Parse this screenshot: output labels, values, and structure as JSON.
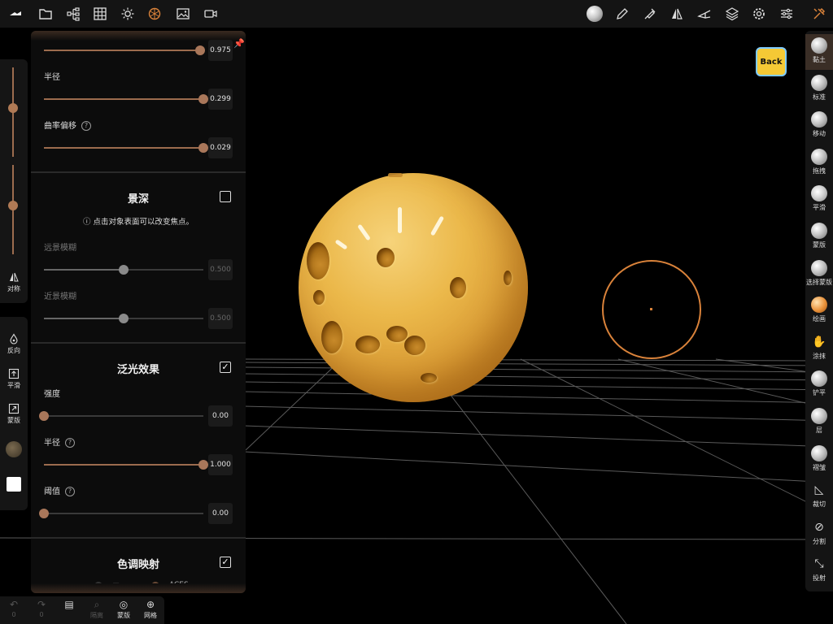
{
  "toolbar": {
    "left_icons": [
      "scene-logo-icon",
      "folder-icon",
      "scene-tree-icon",
      "grid-icon",
      "light-icon",
      "material-icon",
      "image-icon",
      "video-icon"
    ],
    "right_icons": [
      "matcap-icon",
      "pen-icon",
      "stroke-icon",
      "symmetry-icon",
      "camera-icon",
      "layers-icon",
      "settings-icon",
      "sliders-icon",
      "tools-icon"
    ]
  },
  "panel": {
    "top_value": "0.975",
    "radius_label": "半径",
    "radius_value": "0.299",
    "curvature_label": "曲率偏移",
    "curvature_value": "0.029",
    "dof": {
      "title": "景深",
      "info": "点击对象表面可以改变焦点。",
      "far_label": "远景模糊",
      "far_value": "0.500",
      "near_label": "近景模糊",
      "near_value": "0.500",
      "enabled": false
    },
    "bloom": {
      "title": "泛光效果",
      "enabled": true,
      "intensity_label": "强度",
      "intensity_value": "0.00",
      "radius_label": "半径",
      "radius_value": "1.000",
      "threshold_label": "阈值",
      "threshold_value": "0.00"
    },
    "tonemap": {
      "title": "色调映射",
      "enabled": true,
      "option_none": "无",
      "option_aces": "ACES"
    },
    "slider_levels": {
      "top": 0.98,
      "radius": 1.0,
      "curvature": 1.0,
      "far": 0.5,
      "near": 0.5,
      "intensity": 0.0,
      "bloom_radius": 1.0,
      "threshold": 0.0
    }
  },
  "left_strip": {
    "symmetry_label": "对称",
    "invert_label": "反向",
    "smooth_label": "平滑",
    "mask_label": "蒙版",
    "slider_levels": {
      "top": 0.55,
      "bottom": 0.55
    }
  },
  "right_tools": [
    {
      "label": "黏土",
      "icon": "clay-brush-icon",
      "active": true
    },
    {
      "label": "标准",
      "icon": "standard-brush-icon"
    },
    {
      "label": "移动",
      "icon": "move-brush-icon"
    },
    {
      "label": "拖拽",
      "icon": "drag-brush-icon"
    },
    {
      "label": "平滑",
      "icon": "smooth-brush-icon"
    },
    {
      "label": "蒙版",
      "icon": "mask-brush-icon"
    },
    {
      "label": "选择蒙版",
      "icon": "select-mask-icon"
    },
    {
      "label": "绘画",
      "icon": "paint-brush-icon"
    },
    {
      "label": "涂抹",
      "icon": "smudge-icon"
    },
    {
      "label": "铲平",
      "icon": "flatten-icon"
    },
    {
      "label": "层",
      "icon": "layer-brush-icon"
    },
    {
      "label": "褶皱",
      "icon": "crease-icon"
    },
    {
      "label": "裁切",
      "icon": "trim-icon"
    },
    {
      "label": "分割",
      "icon": "split-icon"
    },
    {
      "label": "投射",
      "icon": "project-icon"
    }
  ],
  "viewport": {
    "back_label": "Back",
    "accent": "#d9823a"
  },
  "bottom": {
    "undo_count": "0",
    "redo_count": "0",
    "isolate_label": "隔离",
    "mask_label": "蒙版",
    "wireframe_label": "网格"
  }
}
